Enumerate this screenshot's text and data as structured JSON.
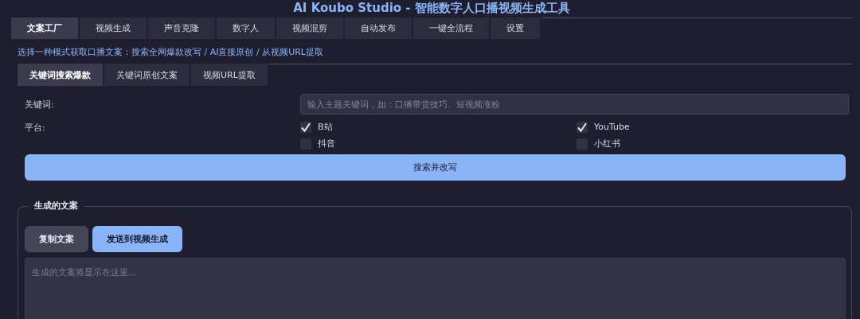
{
  "title": "AI Koubo Studio - 智能数字人口播视频生成工具",
  "tabs": [
    {
      "label": "文案工厂",
      "selected": true
    },
    {
      "label": "视频生成",
      "selected": false
    },
    {
      "label": "声音克隆",
      "selected": false
    },
    {
      "label": "数字人",
      "selected": false
    },
    {
      "label": "视频混剪",
      "selected": false
    },
    {
      "label": "自动发布",
      "selected": false
    },
    {
      "label": "一键全流程",
      "selected": false
    },
    {
      "label": "设置",
      "selected": false
    }
  ],
  "description": "选择一种模式获取口播文案：搜索全网爆款改写 / AI直接原创 / 从视频URL提取",
  "subtabs": [
    {
      "label": "关键词搜索爆款",
      "selected": true
    },
    {
      "label": "关键词原创文案",
      "selected": false
    },
    {
      "label": "视频URL提取",
      "selected": false
    }
  ],
  "keyword": {
    "label": "关键词:",
    "placeholder": "输入主题关键词，如：口播带货技巧、短视频涨粉"
  },
  "platform": {
    "label": "平台:",
    "options": [
      {
        "label": "B站",
        "checked": true
      },
      {
        "label": "YouTube",
        "checked": true
      },
      {
        "label": "抖音",
        "checked": false
      },
      {
        "label": "小红书",
        "checked": false
      }
    ]
  },
  "search_button": "搜索并改写",
  "output": {
    "legend": "生成的文案",
    "buttons": [
      {
        "label": "复制文案",
        "kind": "secondary"
      },
      {
        "label": "发送到视频生成",
        "kind": "primary"
      }
    ],
    "placeholder": "生成的文案将显示在这里..."
  }
}
